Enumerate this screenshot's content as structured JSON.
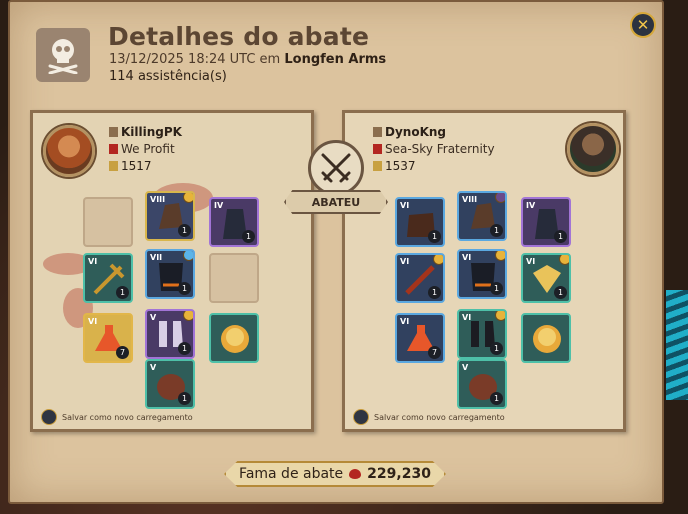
{
  "header": {
    "title": "Detalhes do abate",
    "datetime": "13/12/2025 18:24 UTC em",
    "location": "Longfen Arms",
    "assists": "114 assistência(s)",
    "skull_icon": "skull-crossbones-icon"
  },
  "killer": {
    "name": "KillingPK",
    "guild": "We Profit",
    "ip": "1517",
    "save_label": "Salvar como novo carregamento"
  },
  "victim": {
    "name": "DynoKng",
    "guild": "Sea-Sky Fraternity",
    "ip": "1537",
    "save_label": "Salvar como novo carregamento"
  },
  "center": {
    "label": "ABATEU",
    "icon": "crossed-swords-icon"
  },
  "fame": {
    "label": "Fama de abate",
    "value": "229,230"
  },
  "colors": {
    "accent": "#d6a83a",
    "parchment": "#e6d6b7",
    "blood": "#b32620"
  },
  "killer_slots": {
    "bag": {
      "tier": "",
      "qty": ""
    },
    "head": {
      "tier": "VIII",
      "qty": "1"
    },
    "cape": {
      "tier": "IV",
      "qty": "1"
    },
    "mainhand": {
      "tier": "VI",
      "qty": "1"
    },
    "chest": {
      "tier": "VII",
      "qty": "1"
    },
    "offhand": {
      "tier": "",
      "qty": ""
    },
    "potion": {
      "tier": "VI",
      "qty": "7"
    },
    "shoes": {
      "tier": "V",
      "qty": "1"
    },
    "food": {
      "tier": "",
      "qty": ""
    },
    "mount": {
      "tier": "V",
      "qty": "1"
    }
  },
  "victim_slots": {
    "bag": {
      "tier": "VI",
      "qty": "1"
    },
    "head": {
      "tier": "VIII",
      "qty": "1"
    },
    "cape": {
      "tier": "IV",
      "qty": "1"
    },
    "mainhand": {
      "tier": "VI",
      "qty": "1"
    },
    "chest": {
      "tier": "VI",
      "qty": "1"
    },
    "offhand": {
      "tier": "VI",
      "qty": "1"
    },
    "potion": {
      "tier": "VI",
      "qty": "7"
    },
    "shoes": {
      "tier": "VI",
      "qty": "1"
    },
    "food": {
      "tier": "",
      "qty": ""
    },
    "mount": {
      "tier": "V",
      "qty": "1"
    }
  }
}
